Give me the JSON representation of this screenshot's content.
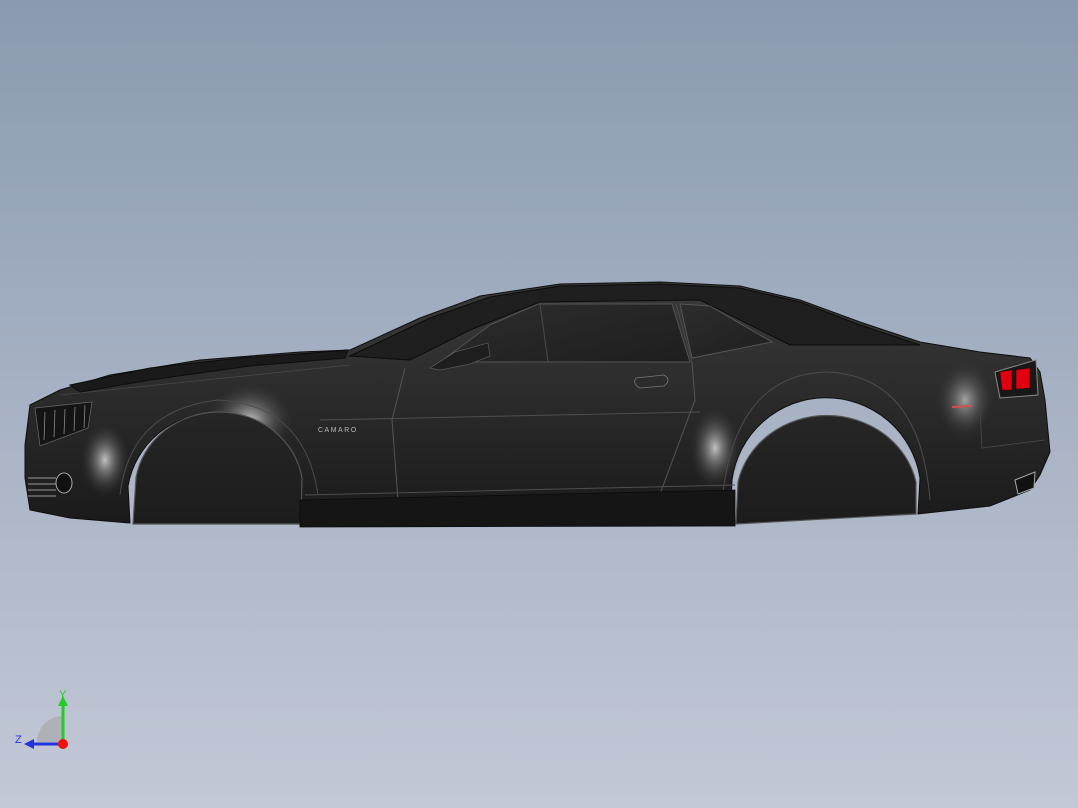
{
  "viewport": {
    "background_top": "#8a9ab0",
    "background_bottom": "#c3c8d6"
  },
  "model": {
    "badge": "CAMARO",
    "body_color": "#2b2b2b",
    "taillight_color": "#e00010"
  },
  "triad": {
    "y_label": "Y",
    "z_label": "Z",
    "y_color": "#22cc22",
    "z_color": "#2233dd",
    "x_color": "#ee1111"
  }
}
